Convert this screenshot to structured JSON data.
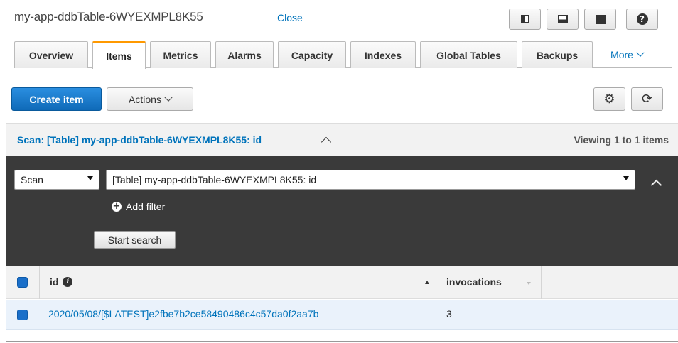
{
  "header": {
    "title": "my-app-ddbTable-6WYEXMPL8K55",
    "close_label": "Close"
  },
  "tabs": [
    {
      "label": "Overview",
      "active": false
    },
    {
      "label": "Items",
      "active": true
    },
    {
      "label": "Metrics",
      "active": false
    },
    {
      "label": "Alarms",
      "active": false
    },
    {
      "label": "Capacity",
      "active": false
    },
    {
      "label": "Indexes",
      "active": false
    },
    {
      "label": "Global Tables",
      "active": false
    },
    {
      "label": "Backups",
      "active": false
    }
  ],
  "more_tab": {
    "label": "More"
  },
  "toolbar": {
    "create_label": "Create item",
    "actions_label": "Actions",
    "settings_icon": "gear-icon",
    "refresh_icon": "refresh-icon"
  },
  "scan_header": {
    "title": "Scan: [Table] my-app-ddbTable-6WYEXMPL8K55: id",
    "viewing": "Viewing 1 to 1 items"
  },
  "scan_panel": {
    "mode_value": "Scan",
    "target_value": "[Table] my-app-ddbTable-6WYEXMPL8K55: id",
    "add_filter_label": "Add filter",
    "start_search_label": "Start search"
  },
  "table": {
    "columns": [
      {
        "label": "id",
        "sort": "asc"
      },
      {
        "label": "invocations",
        "sort": "none"
      }
    ],
    "rows": [
      {
        "id": "2020/05/08/[$LATEST]e2fbe7b2ce58490486c4c57da0f2aa7b",
        "invocations": "3",
        "selected": true
      }
    ]
  },
  "colors": {
    "accent": "#0073bb",
    "primary_button": "#1a73c8",
    "active_tab": "#ff9900",
    "panel_dark": "#3a3a3a"
  }
}
